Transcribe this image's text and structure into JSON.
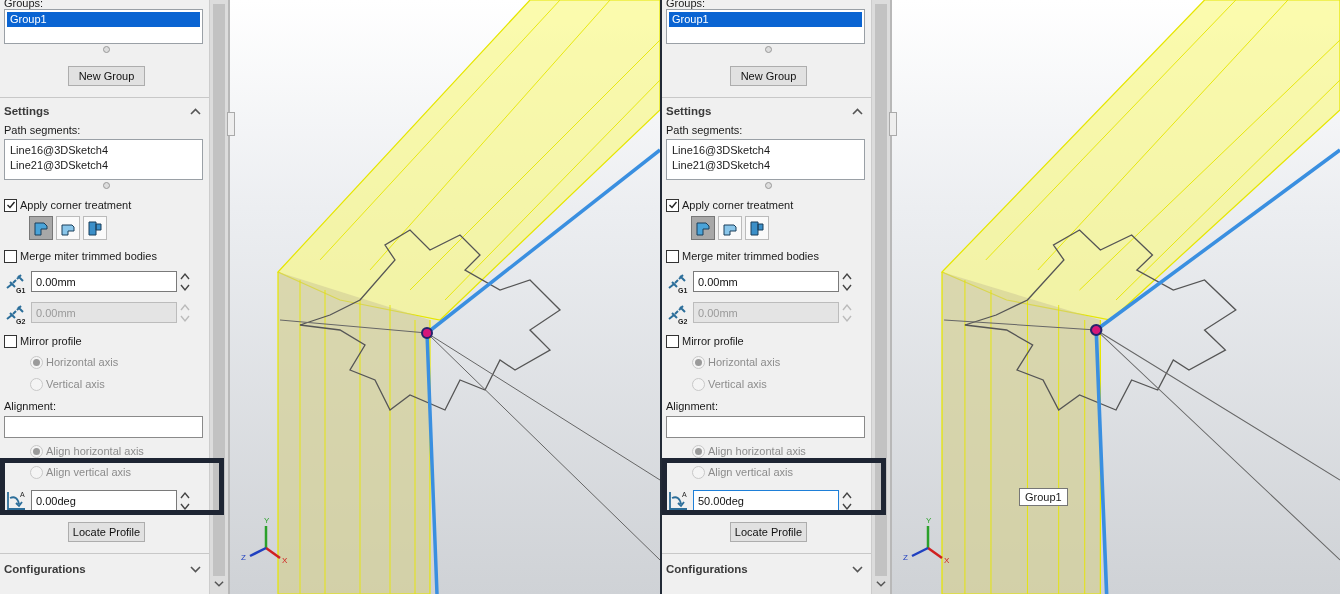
{
  "screens": [
    {
      "groups_label": "Groups:",
      "groups": [
        {
          "label": "Group1",
          "selected": true
        }
      ],
      "new_group_button": "New Group",
      "settings": {
        "title": "Settings",
        "expanded": true
      },
      "path_segments_label": "Path segments:",
      "path_segments": [
        "Line16@3DSketch4",
        "Line21@3DSketch4"
      ],
      "apply_corner_treatment": {
        "label": "Apply corner treatment",
        "checked": true
      },
      "corner_options": [
        {
          "selected": true
        },
        {
          "selected": false
        },
        {
          "selected": false
        }
      ],
      "merge_bodies": {
        "label": "Merge miter trimmed bodies",
        "checked": false
      },
      "gap_fields": [
        {
          "icon_label": "G1",
          "value": "0.00mm",
          "disabled": false
        },
        {
          "icon_label": "G2",
          "value": "0.00mm",
          "disabled": true
        }
      ],
      "mirror_profile": {
        "label": "Mirror profile",
        "checked": false
      },
      "mirror_axes": [
        {
          "label": "Horizontal axis",
          "selected": true,
          "disabled": true
        },
        {
          "label": "Vertical axis",
          "selected": false,
          "disabled": true
        }
      ],
      "alignment_label": "Alignment:",
      "align_axes": [
        {
          "label": "Align horizontal axis",
          "selected": true,
          "disabled": true
        },
        {
          "label": "Align vertical axis",
          "selected": false,
          "disabled": true
        }
      ],
      "rotation_angle": {
        "icon_label": "A",
        "value": "0.00deg",
        "focused": false
      },
      "locate_profile_button": "Locate Profile",
      "configurations": {
        "title": "Configurations",
        "expanded": false
      },
      "viewport": {
        "triad_labels": [
          "Y",
          "Z",
          "X"
        ]
      }
    },
    {
      "groups_label": "Groups:",
      "groups": [
        {
          "label": "Group1",
          "selected": true
        }
      ],
      "new_group_button": "New Group",
      "settings": {
        "title": "Settings",
        "expanded": true
      },
      "path_segments_label": "Path segments:",
      "path_segments": [
        "Line16@3DSketch4",
        "Line21@3DSketch4"
      ],
      "apply_corner_treatment": {
        "label": "Apply corner treatment",
        "checked": true
      },
      "corner_options": [
        {
          "selected": true
        },
        {
          "selected": false
        },
        {
          "selected": false
        }
      ],
      "merge_bodies": {
        "label": "Merge miter trimmed bodies",
        "checked": false
      },
      "gap_fields": [
        {
          "icon_label": "G1",
          "value": "0.00mm",
          "disabled": false
        },
        {
          "icon_label": "G2",
          "value": "0.00mm",
          "disabled": true
        }
      ],
      "mirror_profile": {
        "label": "Mirror profile",
        "checked": false
      },
      "mirror_axes": [
        {
          "label": "Horizontal axis",
          "selected": true,
          "disabled": true
        },
        {
          "label": "Vertical axis",
          "selected": false,
          "disabled": true
        }
      ],
      "alignment_label": "Alignment:",
      "align_axes": [
        {
          "label": "Align horizontal axis",
          "selected": true,
          "disabled": true
        },
        {
          "label": "Align vertical axis",
          "selected": false,
          "disabled": true
        }
      ],
      "rotation_angle": {
        "icon_label": "A",
        "value": "50.00deg",
        "focused": true
      },
      "locate_profile_button": "Locate Profile",
      "configurations": {
        "title": "Configurations",
        "expanded": false
      },
      "viewport": {
        "triad_labels": [
          "Y",
          "Z",
          "X"
        ],
        "tooltip": "Group1"
      }
    }
  ]
}
